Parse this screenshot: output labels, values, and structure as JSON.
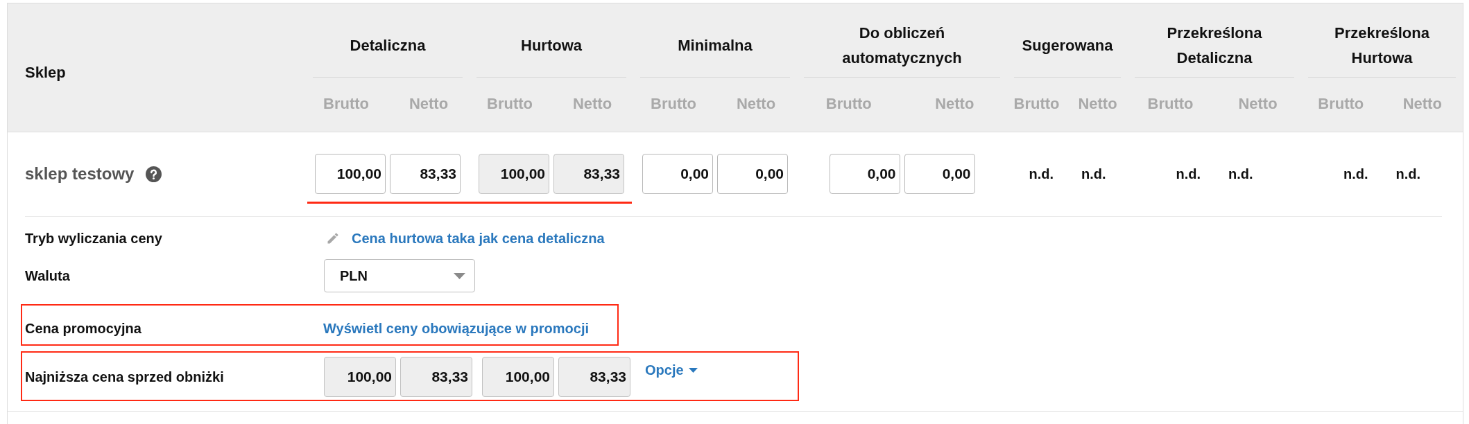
{
  "table": {
    "shop_column": "Sklep",
    "groups": [
      {
        "title": "Detaliczna",
        "subheaders": [
          "Brutto",
          "Netto"
        ]
      },
      {
        "title": "Hurtowa",
        "subheaders": [
          "Brutto",
          "Netto"
        ]
      },
      {
        "title": "Minimalna",
        "subheaders": [
          "Brutto",
          "Netto"
        ]
      },
      {
        "title": "Do obliczeń automatycznych",
        "subheaders": [
          "Brutto",
          "Netto"
        ]
      },
      {
        "title": "Sugerowana",
        "subheaders": [
          "Brutto",
          "Netto"
        ]
      },
      {
        "title": "Przekreślona Detaliczna",
        "subheaders": [
          "Brutto",
          "Netto"
        ]
      },
      {
        "title": "Przekreślona Hurtowa",
        "subheaders": [
          "Brutto",
          "Netto"
        ]
      }
    ],
    "rows": [
      {
        "shop": "sklep testowy",
        "cells": [
          {
            "kind": "inputs",
            "underlined": true,
            "values": [
              {
                "value": "100,00",
                "disabled": false
              },
              {
                "value": "83,33",
                "disabled": false
              }
            ]
          },
          {
            "kind": "inputs",
            "underlined": true,
            "values": [
              {
                "value": "100,00",
                "disabled": true
              },
              {
                "value": "83,33",
                "disabled": true
              }
            ]
          },
          {
            "kind": "inputs",
            "underlined": false,
            "values": [
              {
                "value": "0,00",
                "disabled": false
              },
              {
                "value": "0,00",
                "disabled": false
              }
            ]
          },
          {
            "kind": "inputs",
            "underlined": false,
            "values": [
              {
                "value": "0,00",
                "disabled": false
              },
              {
                "value": "0,00",
                "disabled": false
              }
            ]
          },
          {
            "kind": "text",
            "underlined": false,
            "values": [
              "n.d.",
              "n.d."
            ]
          },
          {
            "kind": "text",
            "underlined": false,
            "values": [
              "n.d.",
              "n.d."
            ]
          },
          {
            "kind": "text",
            "underlined": false,
            "values": [
              "n.d.",
              "n.d."
            ]
          }
        ]
      }
    ]
  },
  "details": [
    {
      "kind": "edit_link",
      "label": "Tryb wyliczania ceny",
      "link": "Cena hurtowa taka jak cena detaliczna",
      "highlighted": false
    },
    {
      "kind": "select",
      "label": "Waluta",
      "value": "PLN",
      "highlighted": false
    },
    {
      "kind": "link",
      "label": "Cena promocyjna",
      "link": "Wyświetl ceny obowiązujące w promocji",
      "highlighted": true
    },
    {
      "kind": "prices",
      "label": "Najniższa cena sprzed obniżki",
      "groups": [
        [
          {
            "value": "100,00",
            "disabled": true
          },
          {
            "value": "83,33",
            "disabled": true
          }
        ],
        [
          {
            "value": "100,00",
            "disabled": true
          },
          {
            "value": "83,33",
            "disabled": true
          }
        ]
      ],
      "menu": "Opcje",
      "highlighted": true
    }
  ]
}
